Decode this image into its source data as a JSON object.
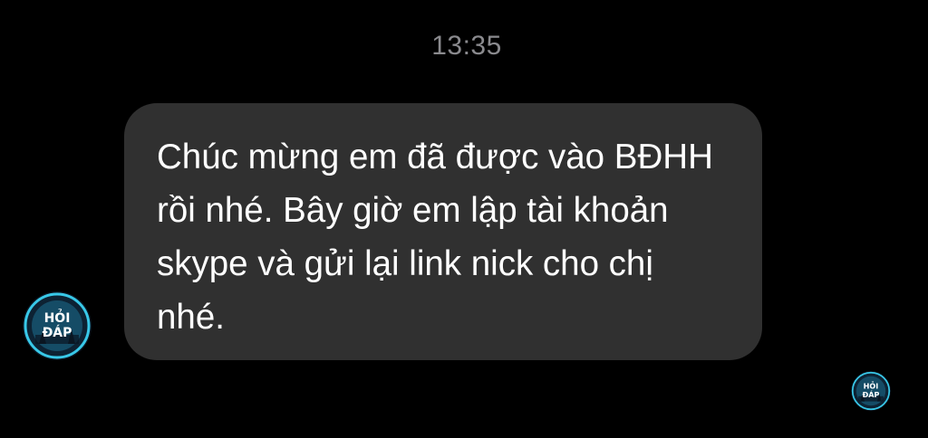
{
  "chat": {
    "timestamp": "13:35",
    "messages": [
      {
        "sender": "other",
        "text": "Chúc mừng em đã được vào BĐHH rồi nhé. Bây giờ em lập tài khoản skype và gửi lại link nick cho chị nhé."
      }
    ],
    "avatar": {
      "icon": "avatar-hoi-dap-icon",
      "logo_text_line1": "HỎI",
      "logo_text_line2": "ĐÁP"
    }
  },
  "colors": {
    "background": "#000000",
    "bubble": "#303030",
    "message_text": "#ffffff",
    "timestamp_text": "#8a8a8e",
    "avatar_bg": "#0a1622",
    "avatar_ring": "#38c8e8"
  }
}
